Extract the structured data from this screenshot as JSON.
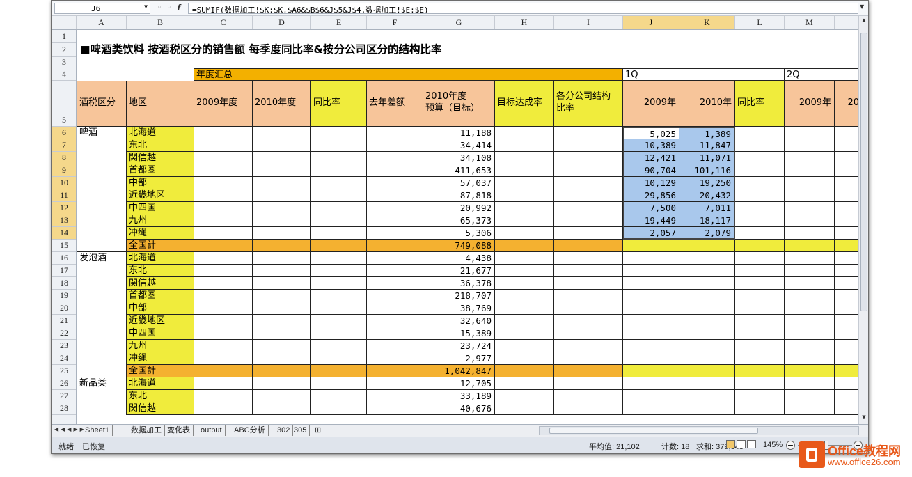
{
  "formula_bar": {
    "name_box": "J6",
    "formula": "=SUMIF(数据加工!$K:$K,$A6&$B$6&J$5&J$4,数据加工!$E:$E)"
  },
  "columns": [
    "A",
    "B",
    "C",
    "D",
    "E",
    "F",
    "G",
    "H",
    "I",
    "J",
    "K",
    "L",
    "M",
    ""
  ],
  "selected_columns": [
    "J",
    "K"
  ],
  "rows": [
    "1",
    "2",
    "3",
    "4",
    "5",
    "6",
    "7",
    "8",
    "9",
    "10",
    "11",
    "12",
    "13",
    "14",
    "15",
    "16",
    "17",
    "18",
    "19",
    "20",
    "21",
    "22",
    "23",
    "24",
    "25",
    "26",
    "27",
    "28"
  ],
  "selected_rows": [
    "6",
    "7",
    "8",
    "9",
    "10",
    "11",
    "12",
    "13",
    "14"
  ],
  "sheet": {
    "title": "■啤酒类饮料 按酒税区分的销售额 每季度同比率&按分公司区分的结构比率",
    "group_annual": "年度汇总",
    "group_1q": "1Q",
    "group_2q": "2Q",
    "headers": {
      "a": "酒税区分",
      "b": "地区",
      "c": "2009年度",
      "d": "2010年度",
      "e": "同比率",
      "f": "去年差额",
      "g1": "2010年度",
      "g2": "预算（目标）",
      "h": "目标达成率",
      "i1": "各分公司结构",
      "i2": "比率",
      "j": "2009年",
      "k": "2010年",
      "l": "同比率",
      "m": "2009年",
      "n": "20"
    },
    "groups": [
      {
        "category": "啤酒",
        "regions": [
          "北海道",
          "东北",
          "関信越",
          "首都圏",
          "中部",
          "近畿地区",
          "中四国",
          "九州",
          "冲绳",
          "全国計"
        ],
        "budget": [
          "11,188",
          "34,414",
          "34,108",
          "411,653",
          "57,037",
          "87,818",
          "20,992",
          "65,373",
          "5,306",
          "749,088"
        ],
        "q1_2009": [
          "5,025",
          "10,389",
          "12,421",
          "90,704",
          "10,129",
          "29,856",
          "7,500",
          "19,449",
          "2,057"
        ],
        "q1_2010": [
          "1,389",
          "11,847",
          "11,071",
          "101,116",
          "19,250",
          "20,432",
          "7,011",
          "18,117",
          "2,079"
        ]
      },
      {
        "category": "发泡酒",
        "regions": [
          "北海道",
          "东北",
          "関信越",
          "首都圏",
          "中部",
          "近畿地区",
          "中四国",
          "九州",
          "冲绳",
          "全国計"
        ],
        "budget": [
          "4,438",
          "21,677",
          "36,378",
          "218,707",
          "38,769",
          "32,640",
          "15,389",
          "23,724",
          "2,977",
          "1,042,847"
        ]
      },
      {
        "category": "新品类",
        "regions": [
          "北海道",
          "东北",
          "関信越"
        ],
        "budget": [
          "12,705",
          "33,189",
          "40,676"
        ]
      }
    ]
  },
  "tabs": [
    "Sheet1",
    "数据加工",
    "变化表",
    "output",
    "ABC分析",
    "302",
    "305"
  ],
  "status": {
    "ready": "就绪",
    "recovered": "已恢复",
    "average": "平均值: 21,102",
    "count": "计数: 18",
    "sum": "求和: 379,843",
    "zoom": "145%"
  },
  "logo": {
    "name": "Office教程网",
    "url": "www.office26.com"
  },
  "colors": {
    "header_peach": "#f7c59a",
    "region_yellow": "#f0ec3c",
    "total_orange": "#f4b130",
    "title_bar_orange": "#f3b000",
    "selection_blue": "#a9c8ec",
    "header_bg": "#eef1f5",
    "selected_header": "#f5d88b"
  }
}
